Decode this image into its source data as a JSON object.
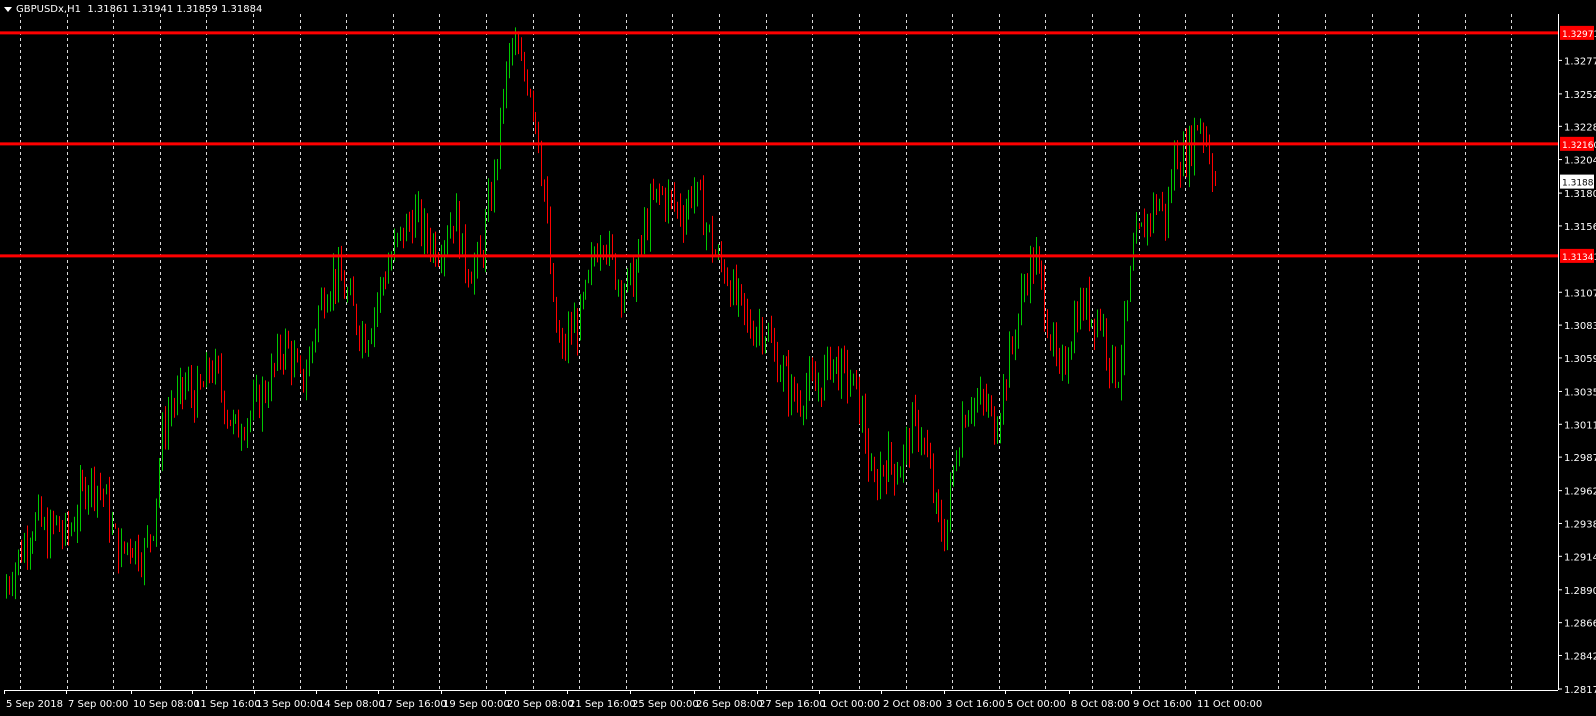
{
  "header": {
    "symbol_info": "GBPUSDx,H1",
    "ohlc": "1.31861 1.31941 1.31859 1.31884"
  },
  "colors": {
    "background": "#000000",
    "bull": "#00c800",
    "bear": "#ff0000",
    "grid": "#ffffff",
    "level_line": "#ff0000",
    "text": "#ffffff"
  },
  "chart_data": {
    "type": "candlestick",
    "symbol": "GBPUSDx",
    "timeframe": "H1",
    "grid": true,
    "ylim": [
      1.28175,
      1.33036
    ],
    "y_ticks": [
      "1.32770",
      "1.32525",
      "1.32288",
      "1.32045",
      "1.31800",
      "1.31560",
      "1.31075",
      "1.30835",
      "1.30595",
      "1.30350",
      "1.30110",
      "1.29870",
      "1.29625",
      "1.29385",
      "1.29145",
      "1.28900",
      "1.28660",
      "1.28420",
      "1.28175"
    ],
    "x_ticks": [
      "5 Sep 2018",
      "7 Sep 00:00",
      "10 Sep 08:00",
      "11 Sep 16:00",
      "13 Sep 00:00",
      "14 Sep 08:00",
      "17 Sep 16:00",
      "19 Sep 00:00",
      "20 Sep 08:00",
      "21 Sep 16:00",
      "25 Sep 00:00",
      "26 Sep 08:00",
      "27 Sep 16:00",
      "1 Oct 00:00",
      "2 Oct 08:00",
      "3 Oct 16:00",
      "5 Oct 00:00",
      "8 Oct 08:00",
      "9 Oct 16:00",
      "11 Oct 00:00"
    ],
    "horizontal_levels": [
      {
        "label": "1.32971",
        "value": 1.32971
      },
      {
        "label": "1.32160",
        "value": 1.3216
      },
      {
        "label": "1.31341",
        "value": 1.31341
      }
    ],
    "current_price": {
      "label": "1.31884",
      "value": 1.31884
    },
    "close_path": [
      1.2895,
      1.2908,
      1.2922,
      1.2935,
      1.2941,
      1.2927,
      1.294,
      1.2928,
      1.2936,
      1.2957,
      1.297,
      1.2968,
      1.296,
      1.2931,
      1.2915,
      1.2927,
      1.292,
      1.2917,
      1.294,
      1.3,
      1.3025,
      1.3028,
      1.304,
      1.303,
      1.3035,
      1.3055,
      1.3042,
      1.3021,
      1.3005,
      1.3015,
      1.3019,
      1.3029,
      1.304,
      1.3055,
      1.307,
      1.306,
      1.304,
      1.3055,
      1.309,
      1.311,
      1.312,
      1.3115,
      1.31,
      1.3085,
      1.3075,
      1.3095,
      1.3115,
      1.313,
      1.3145,
      1.3155,
      1.3165,
      1.315,
      1.3145,
      1.314,
      1.3155,
      1.3165,
      1.313,
      1.3125,
      1.313,
      1.3165,
      1.32,
      1.326,
      1.329,
      1.327,
      1.3262,
      1.323,
      1.3175,
      1.309,
      1.306,
      1.308,
      1.3085,
      1.3105,
      1.3135,
      1.3155,
      1.313,
      1.3115,
      1.3112,
      1.312,
      1.315,
      1.317,
      1.318,
      1.3175,
      1.317,
      1.3165,
      1.3185,
      1.317,
      1.315,
      1.313,
      1.3125,
      1.3105,
      1.3095,
      1.308,
      1.3085,
      1.308,
      1.306,
      1.305,
      1.3035,
      1.3028,
      1.304,
      1.3035,
      1.3045,
      1.306,
      1.305,
      1.3045,
      1.3035,
      1.301,
      1.296,
      1.298,
      1.2985,
      1.2978,
      1.299,
      1.301,
      1.3005,
      1.2975,
      1.294,
      1.293,
      1.298,
      1.3015,
      1.303,
      1.3025,
      1.3025,
      1.301,
      1.3035,
      1.3065,
      1.3095,
      1.3125,
      1.313,
      1.3105,
      1.307,
      1.304,
      1.307,
      1.3095,
      1.3098,
      1.309,
      1.309,
      1.306,
      1.3045,
      1.3085,
      1.314,
      1.315,
      1.3165,
      1.3175,
      1.316,
      1.321,
      1.3205,
      1.3215,
      1.3235,
      1.322,
      1.3188
    ]
  }
}
